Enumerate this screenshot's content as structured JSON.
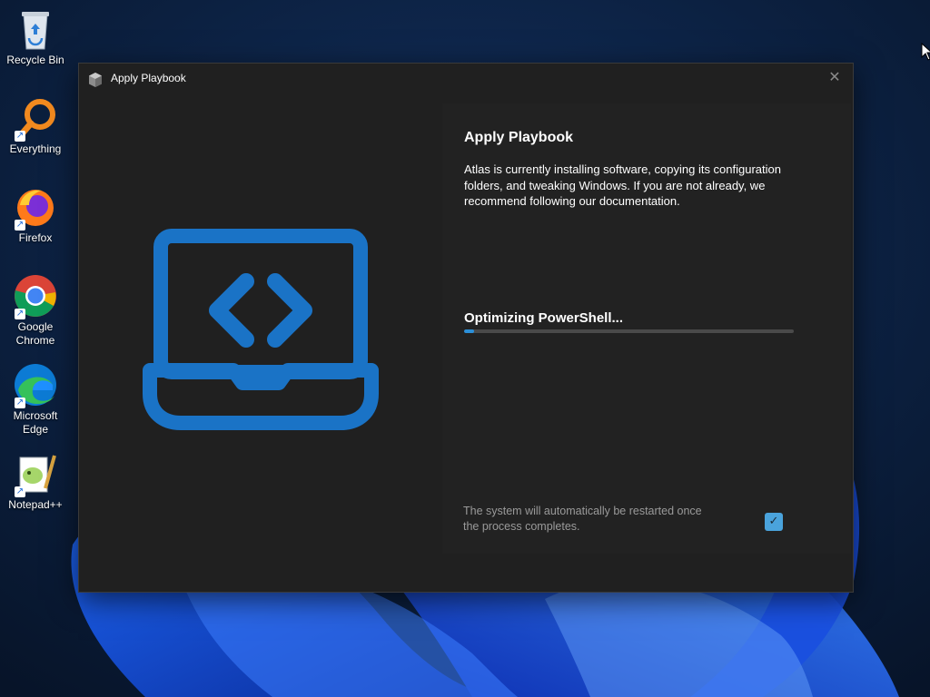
{
  "desktop": {
    "icons": [
      {
        "label": "Recycle Bin",
        "icon": "recycle-bin-icon"
      },
      {
        "label": "Everything",
        "icon": "everything-search-icon"
      },
      {
        "label": "Firefox",
        "icon": "firefox-icon"
      },
      {
        "label": "Google Chrome",
        "icon": "chrome-icon"
      },
      {
        "label": "Microsoft Edge",
        "icon": "edge-icon"
      },
      {
        "label": "Notepad++",
        "icon": "notepad-plus-plus-icon"
      }
    ],
    "shortcut_glyph": "↗"
  },
  "window": {
    "title": "Apply Playbook",
    "close_glyph": "✕",
    "heading": "Apply Playbook",
    "description": "Atlas is currently installing software, copying its configuration folders, and tweaking Windows. If you are not already, we recommend following our documentation.",
    "status": "Optimizing PowerShell...",
    "progress_fraction": 0.03,
    "restart_note": "The system will automatically be restarted once the process completes.",
    "restart_checked": true,
    "check_glyph": "✓",
    "art_icon": "laptop-code-icon"
  },
  "colors": {
    "accent": "#2b8fd8",
    "art_blue": "#1a73c6",
    "window_bg": "#202020",
    "desktop_bg": "#0a1a3a"
  }
}
